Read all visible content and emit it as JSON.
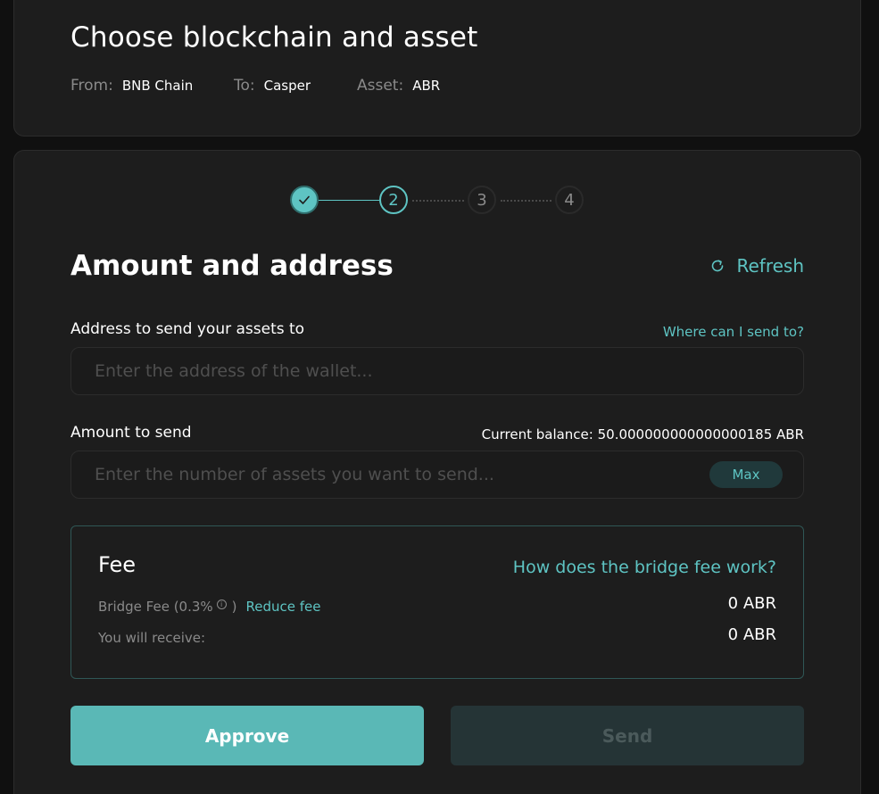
{
  "header": {
    "title": "Choose blockchain and asset",
    "from_label": "From:",
    "from_value": "BNB Chain",
    "to_label": "To:",
    "to_value": "Casper",
    "asset_label": "Asset:",
    "asset_value": "ABR"
  },
  "stepper": {
    "steps": [
      "1",
      "2",
      "3",
      "4"
    ],
    "current": 2
  },
  "section": {
    "title": "Amount and address",
    "refresh_label": "Refresh"
  },
  "address": {
    "label": "Address to send your assets to",
    "help_link": "Where can I send to?",
    "placeholder": "Enter the address of the wallet...",
    "value": ""
  },
  "amount": {
    "label": "Amount to send",
    "balance": "Current balance: 50.000000000000000185 ABR",
    "placeholder": "Enter the number of assets you want to send...",
    "value": "",
    "max_label": "Max"
  },
  "fee": {
    "title": "Fee",
    "how_link": "How does the bridge fee work?",
    "bridge_fee_label": "Bridge Fee (0.3%",
    "bridge_fee_close": ")",
    "reduce_link": "Reduce fee",
    "bridge_fee_value": "0 ABR",
    "receive_label": "You will receive:",
    "receive_value": "0 ABR"
  },
  "actions": {
    "approve_label": "Approve",
    "send_label": "Send"
  },
  "colors": {
    "accent": "#5ec4c3",
    "background": "#101010",
    "card": "#1d1d1d",
    "approve": "#5ab8b6",
    "send_disabled": "#253436"
  }
}
